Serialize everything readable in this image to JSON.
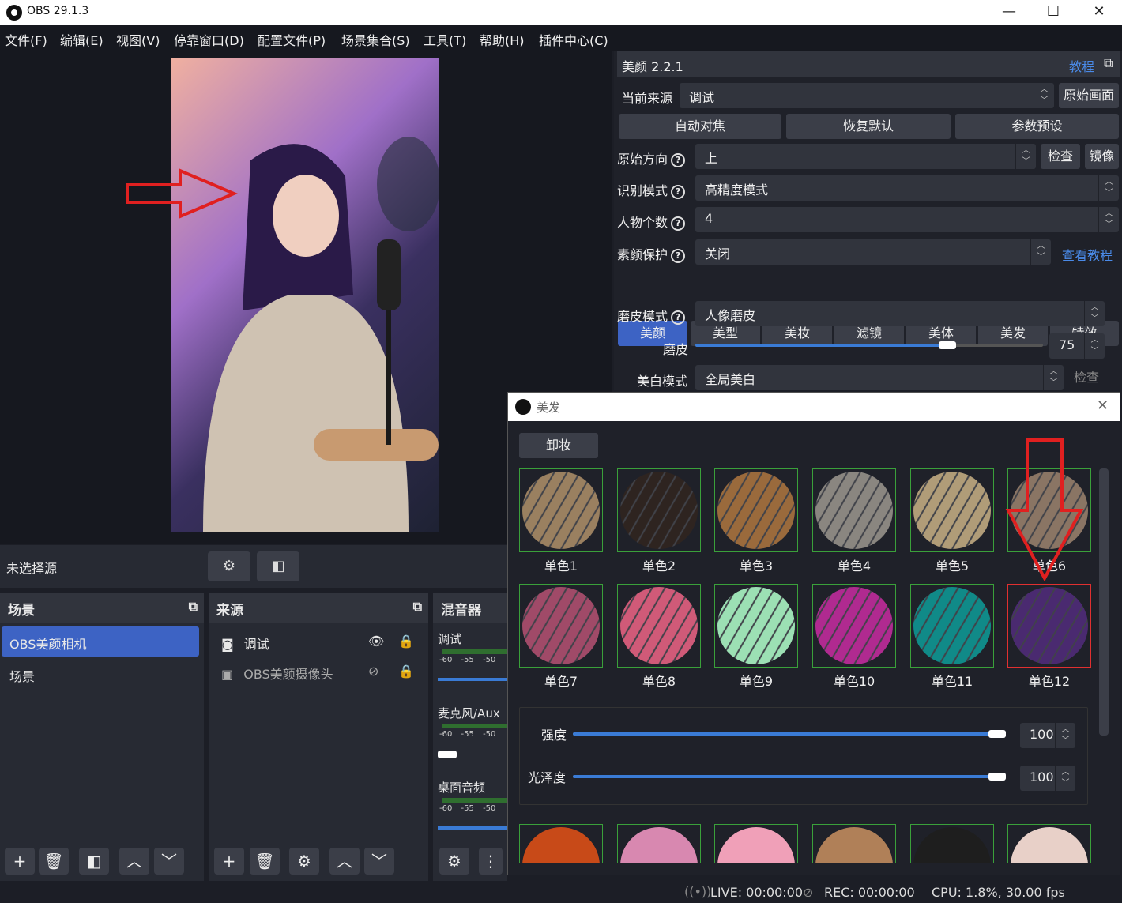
{
  "window": {
    "title": "OBS 29.1.3",
    "minimize": "—",
    "maximize": "☐",
    "close": "✕"
  },
  "menu": [
    "文件(F)",
    "编辑(E)",
    "视图(V)",
    "停靠窗口(D)",
    "配置文件(P)",
    "场景集合(S)",
    "工具(T)",
    "帮助(H)",
    "插件中心(C)"
  ],
  "preview": {
    "no_source": "未选择源"
  },
  "scenes": {
    "header": "场景",
    "items": [
      "OBS美颜相机",
      "场景"
    ]
  },
  "sources": {
    "header": "来源",
    "items": [
      "调试",
      "OBS美颜摄像头"
    ]
  },
  "mixer": {
    "header": "混音器",
    "tracks": [
      "调试",
      "麦克风/Aux",
      "桌面音频"
    ],
    "ticks": [
      "-60",
      "-55",
      "-50"
    ]
  },
  "plugin": {
    "title": "美颜 2.2.1",
    "tutorial_link": "教程",
    "current_source_label": "当前来源",
    "current_source_value": "调试",
    "original_button": "原始画面",
    "auto_focus": "自动对焦",
    "restore_default": "恢复默认",
    "preset": "参数预设",
    "direction_label": "原始方向",
    "direction_value": "上",
    "check": "检查",
    "mirror": "镜像",
    "mode_label": "识别模式",
    "mode_value": "高精度模式",
    "count_label": "人物个数",
    "count_value": "4",
    "protect_label": "素颜保护",
    "protect_value": "关闭",
    "view_tutorial": "查看教程",
    "tabs": [
      "美颜",
      "美型",
      "美妆",
      "滤镜",
      "美体",
      "美发",
      "特效"
    ],
    "smooth_mode_label": "磨皮模式",
    "smooth_mode_value": "人像磨皮",
    "smooth_label": "磨皮",
    "smooth_value": "75",
    "smooth_fraction": 0.75,
    "whiten_label": "美白模式",
    "whiten_value": "全局美白",
    "whiten_check": "检查"
  },
  "hair_dialog": {
    "title": "美发",
    "remove_button": "卸妆",
    "swatches": [
      {
        "label": "单色1",
        "color": "#9a8060"
      },
      {
        "label": "单色2",
        "color": "#2e2420"
      },
      {
        "label": "单色3",
        "color": "#9a6a3c"
      },
      {
        "label": "单色4",
        "color": "#8a8680"
      },
      {
        "label": "单色5",
        "color": "#b09c78"
      },
      {
        "label": "单色6",
        "color": "#8a7564"
      },
      {
        "label": "单色7",
        "color": "#a04a68"
      },
      {
        "label": "单色8",
        "color": "#d05a78"
      },
      {
        "label": "单色9",
        "color": "#9ce0b4"
      },
      {
        "label": "单色10",
        "color": "#b02a90"
      },
      {
        "label": "单色11",
        "color": "#108a88"
      },
      {
        "label": "单色12",
        "color": "#4a2a70"
      }
    ],
    "more_swatches": [
      "#c84a18",
      "#d888b0",
      "#f0a0b8",
      "#b08058",
      "#1e1e1e",
      "#e8d0c8"
    ],
    "strength_label": "强度",
    "strength_value": "100",
    "strength_fraction": 1,
    "gloss_label": "光泽度",
    "gloss_value": "100",
    "gloss_fraction": 1
  },
  "status": {
    "live": "LIVE: 00:00:00",
    "rec": "REC: 00:00:00",
    "cpu": "CPU: 1.8%, 30.00 fps"
  }
}
